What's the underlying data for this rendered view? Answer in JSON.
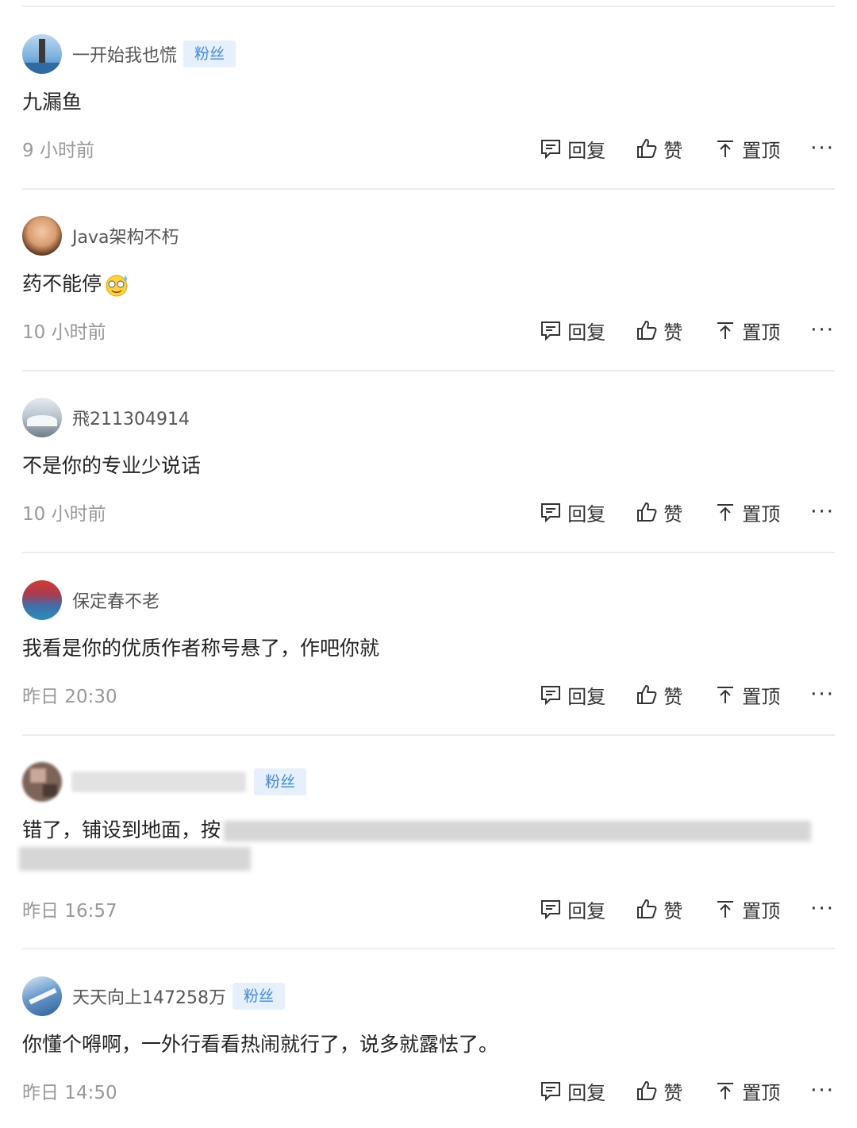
{
  "actions": {
    "reply": "回复",
    "like": "赞",
    "pin": "置顶",
    "more": "···"
  },
  "comments": [
    {
      "username": "一开始我也慌",
      "badge": "粉丝",
      "content": "九漏鱼",
      "time": "9 小时前",
      "avatar_color": "#4f8fc9"
    },
    {
      "username": "Java架构不朽",
      "badge": "",
      "content": "药不能停",
      "emoji": "sweat-smile-emoji",
      "time": "10 小时前",
      "avatar_color": "#8a5a3c"
    },
    {
      "username": "飛211304914",
      "badge": "",
      "content": "不是你的专业少说话",
      "time": "10 小时前",
      "avatar_color": "#b8c0c8"
    },
    {
      "username": "保定春不老",
      "badge": "",
      "content": "我看是你的优质作者称号悬了，作吧你就",
      "time": "昨日 20:30",
      "avatar_color": "#2f6fa8"
    },
    {
      "username": "",
      "badge": "粉丝",
      "content": "错了，铺设到地面，按",
      "time": "昨日 16:57",
      "avatar_color": "#7d6458",
      "blurred": true
    },
    {
      "username": "天天向上147258万",
      "badge": "粉丝",
      "content": "你懂个嘚啊，一外行看看热闹就行了，说多就露怯了。",
      "time": "昨日 14:50",
      "avatar_color": "#3c6fa6"
    }
  ]
}
